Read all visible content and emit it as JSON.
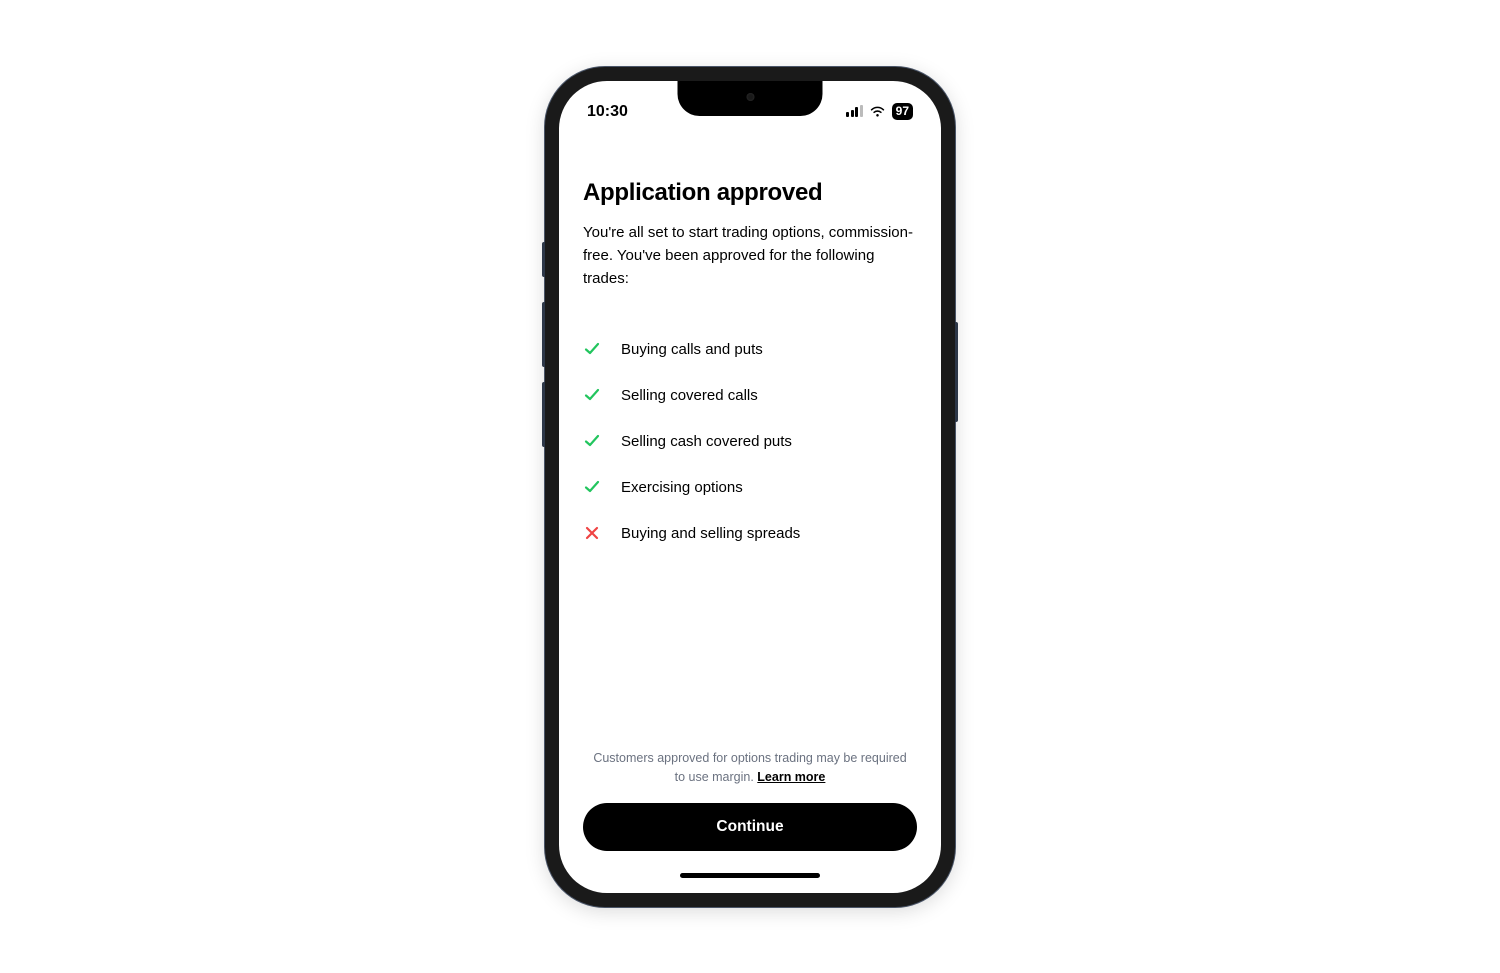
{
  "statusBar": {
    "time": "10:30",
    "batteryPercent": "97"
  },
  "header": {
    "title": "Application approved",
    "subtitle": "You're all set to start trading options, commission-free. You've been approved for the following trades:"
  },
  "trades": [
    {
      "label": "Buying calls and puts",
      "approved": true
    },
    {
      "label": "Selling covered calls",
      "approved": true
    },
    {
      "label": "Selling cash covered puts",
      "approved": true
    },
    {
      "label": "Exercising options",
      "approved": true
    },
    {
      "label": "Buying and selling spreads",
      "approved": false
    }
  ],
  "footer": {
    "disclaimer": "Customers approved for options trading may be required to use margin. ",
    "learnMore": "Learn more",
    "continueLabel": "Continue"
  },
  "colors": {
    "approved": "#22c55e",
    "denied": "#ef4444",
    "buttonBg": "#000000",
    "buttonText": "#ffffff"
  }
}
